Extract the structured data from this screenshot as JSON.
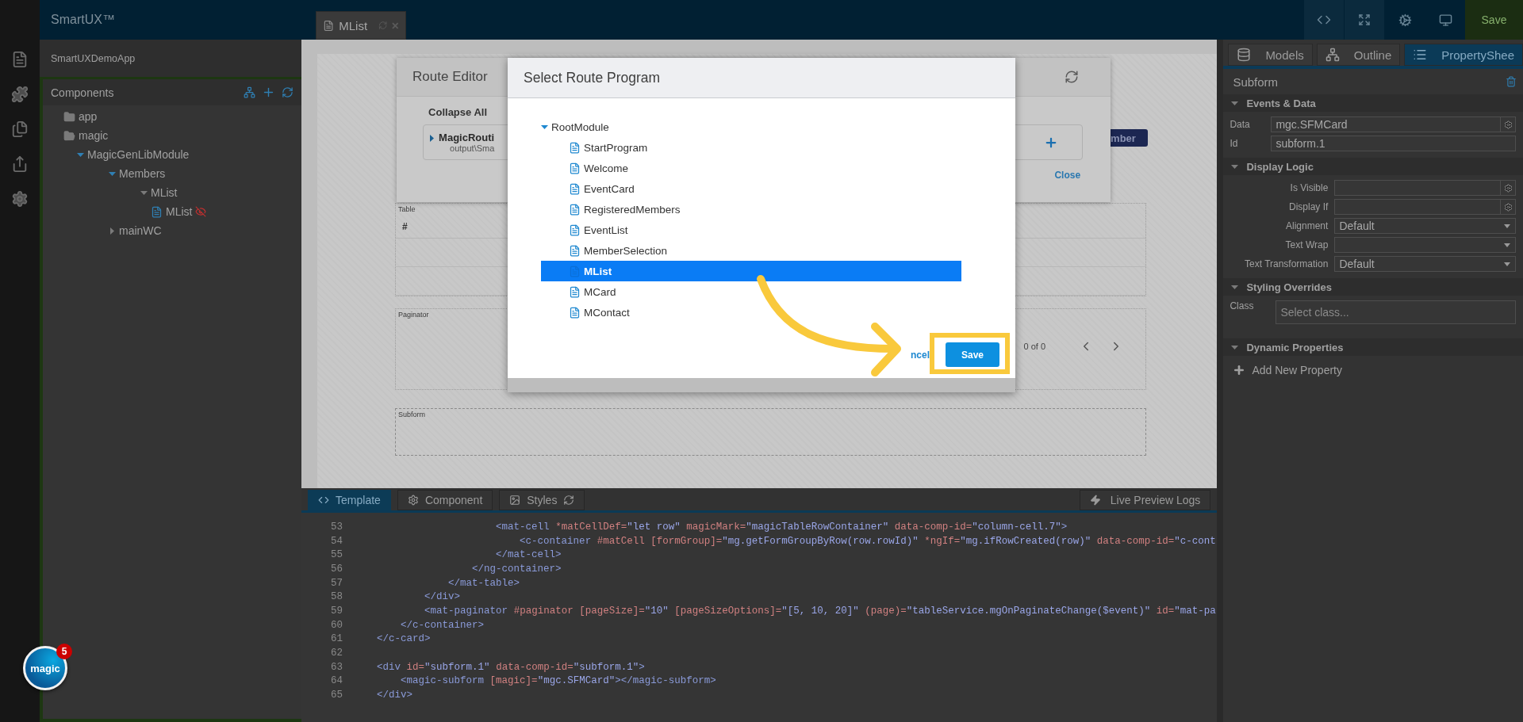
{
  "top_bar": {
    "brand": "SmartUX™",
    "tabs": [
      {
        "label": "MList",
        "selected": true
      }
    ],
    "save": "Save"
  },
  "project": {
    "name": "SmartUXDemoApp"
  },
  "components": {
    "title": "Components",
    "tree": [
      {
        "label": "app",
        "kind": "folder",
        "expanded": false
      },
      {
        "label": "magic",
        "kind": "folder",
        "expanded": true,
        "children": [
          {
            "label": "MagicGenLibModule",
            "kind": "module",
            "expanded": true,
            "children": [
              {
                "label": "Members",
                "kind": "module",
                "expanded": true,
                "children": [
                  {
                    "label": "MList",
                    "kind": "module",
                    "expanded": true,
                    "children": [
                      {
                        "label": "MList",
                        "kind": "file",
                        "hidden": true
                      }
                    ]
                  }
                ]
              },
              {
                "label": "mainWC",
                "kind": "module",
                "expanded": false
              }
            ]
          }
        ]
      }
    ]
  },
  "canvas": {
    "member_button": "mber",
    "table": {
      "label": "Table",
      "header": "#"
    },
    "paginator": {
      "label": "Paginator",
      "range": "0 of 0"
    },
    "subform": {
      "label": "Subform"
    }
  },
  "route_editor": {
    "title": "Route Editor",
    "collapse_all": "Collapse All",
    "route": {
      "name": "MagicRouti",
      "path": "output\\Sma",
      "expanded": false
    },
    "close": "Close"
  },
  "editor": {
    "tabs": [
      {
        "label": "Template",
        "selected": true
      },
      {
        "label": "Component",
        "selected": false
      },
      {
        "label": "Styles",
        "selected": false
      }
    ],
    "live_preview": "Live Preview Logs",
    "lines": [
      {
        "number": "53",
        "tokens": [
          {
            "kind": "tag",
            "text": "                        <mat-cell"
          },
          {
            "kind": "attr",
            "text": " *matCellDef="
          },
          {
            "kind": "str",
            "text": "\"let row\""
          },
          {
            "kind": "attr",
            "text": " magicMark="
          },
          {
            "kind": "str",
            "text": "\"magicTableRowContainer\""
          },
          {
            "kind": "attr",
            "text": " data-comp-id="
          },
          {
            "kind": "str",
            "text": "\"column-cell.7\""
          },
          {
            "kind": "tag",
            "text": ">"
          }
        ]
      },
      {
        "number": "54",
        "tokens": [
          {
            "kind": "tag",
            "text": "                            <c-container"
          },
          {
            "kind": "attr",
            "text": " #matCell [formGroup]="
          },
          {
            "kind": "str",
            "text": "\"mg.getFormGroupByRow(row.rowId)\""
          },
          {
            "kind": "attr",
            "text": " *ngIf="
          },
          {
            "kind": "str",
            "text": "\"mg.ifRowCreated(row)\""
          },
          {
            "kind": "attr",
            "text": " data-comp-id="
          },
          {
            "kind": "str",
            "text": "\"c-cont"
          }
        ]
      },
      {
        "number": "55",
        "tokens": [
          {
            "kind": "tag",
            "text": "                        </mat-cell>"
          }
        ]
      },
      {
        "number": "56",
        "tokens": [
          {
            "kind": "tag",
            "text": "                    </ng-container>"
          }
        ]
      },
      {
        "number": "57",
        "tokens": [
          {
            "kind": "tag",
            "text": "                </mat-table>"
          }
        ]
      },
      {
        "number": "58",
        "tokens": [
          {
            "kind": "tag",
            "text": "            </div>"
          }
        ]
      },
      {
        "number": "59",
        "tokens": [
          {
            "kind": "tag",
            "text": "            <mat-paginator"
          },
          {
            "kind": "attr",
            "text": " #paginator [pageSize]="
          },
          {
            "kind": "str",
            "text": "\"10\""
          },
          {
            "kind": "attr",
            "text": " [pageSizeOptions]="
          },
          {
            "kind": "str",
            "text": "\"[5, 10, 20]\""
          },
          {
            "kind": "attr",
            "text": " (page)="
          },
          {
            "kind": "str",
            "text": "\"tableService.mgOnPaginateChange($event)\""
          },
          {
            "kind": "attr",
            "text": " id="
          },
          {
            "kind": "str",
            "text": "\"mat-pa"
          }
        ]
      },
      {
        "number": "60",
        "tokens": [
          {
            "kind": "tag",
            "text": "        </c-container>"
          }
        ]
      },
      {
        "number": "61",
        "tokens": [
          {
            "kind": "tag",
            "text": "    </c-card>"
          }
        ]
      },
      {
        "number": "62"
      },
      {
        "number": "63",
        "tokens": [
          {
            "kind": "tag",
            "text": "    <div"
          },
          {
            "kind": "attr",
            "text": " id="
          },
          {
            "kind": "str",
            "text": "\"subform.1\""
          },
          {
            "kind": "attr",
            "text": " data-comp-id="
          },
          {
            "kind": "str",
            "text": "\"subform.1\""
          },
          {
            "kind": "tag",
            "text": ">"
          }
        ]
      },
      {
        "number": "64",
        "tokens": [
          {
            "kind": "tag",
            "text": "        <magic-subform"
          },
          {
            "kind": "attr",
            "text": " [magic]="
          },
          {
            "kind": "str",
            "text": "\"mgc.SFMCard\""
          },
          {
            "kind": "tag",
            "text": "></magic-subform>"
          }
        ]
      },
      {
        "number": "65",
        "tokens": [
          {
            "kind": "tag",
            "text": "    </div>"
          }
        ]
      }
    ]
  },
  "properties": {
    "tabs": [
      {
        "label": "Models",
        "selected": false
      },
      {
        "label": "Outline",
        "selected": false
      },
      {
        "label": "PropertyShee",
        "selected": true
      }
    ],
    "title": "Subform",
    "sections": [
      {
        "title": "Events & Data",
        "expanded": true,
        "kind": "narrow",
        "rows": [
          {
            "kind": "input-gear",
            "label": "Data",
            "value": "mgc.SFMCard"
          },
          {
            "kind": "input",
            "label": "Id",
            "value": "subform.1"
          }
        ]
      },
      {
        "title": "Display Logic",
        "expanded": true,
        "kind": "wide",
        "rows": [
          {
            "kind": "input-gear",
            "label": "Is Visible"
          },
          {
            "kind": "input-gear",
            "label": "Display If"
          },
          {
            "kind": "select",
            "label": "Alignment",
            "value": "Default"
          },
          {
            "kind": "select",
            "label": "Text Wrap"
          },
          {
            "kind": "select",
            "label": "Text Transformation",
            "value": "Default"
          }
        ]
      },
      {
        "title": "Styling Overrides",
        "expanded": true,
        "kind": "class",
        "rows": [
          {
            "kind": "input",
            "label": "Class",
            "placeholder": "Select class..."
          }
        ]
      },
      {
        "title": "Dynamic Properties",
        "expanded": true,
        "kind": "add",
        "add": "Add New Property"
      }
    ]
  },
  "dialog": {
    "title": "Select Route Program",
    "tree": [
      {
        "label": "RootModule",
        "expanded": true,
        "children": [
          {
            "label": "StartProgram",
            "selected": false
          },
          {
            "label": "Welcome",
            "selected": false
          },
          {
            "label": "EventCard",
            "selected": false
          },
          {
            "label": "RegisteredMembers",
            "selected": false
          },
          {
            "label": "EventList",
            "selected": false
          },
          {
            "label": "MemberSelection",
            "selected": false
          },
          {
            "label": "MList",
            "selected": true
          },
          {
            "label": "MCard",
            "selected": false
          },
          {
            "label": "MContact",
            "selected": false
          }
        ]
      }
    ],
    "cancel": "ncel",
    "save": "Save"
  },
  "assistant": {
    "logo": "magic",
    "count": "5"
  }
}
